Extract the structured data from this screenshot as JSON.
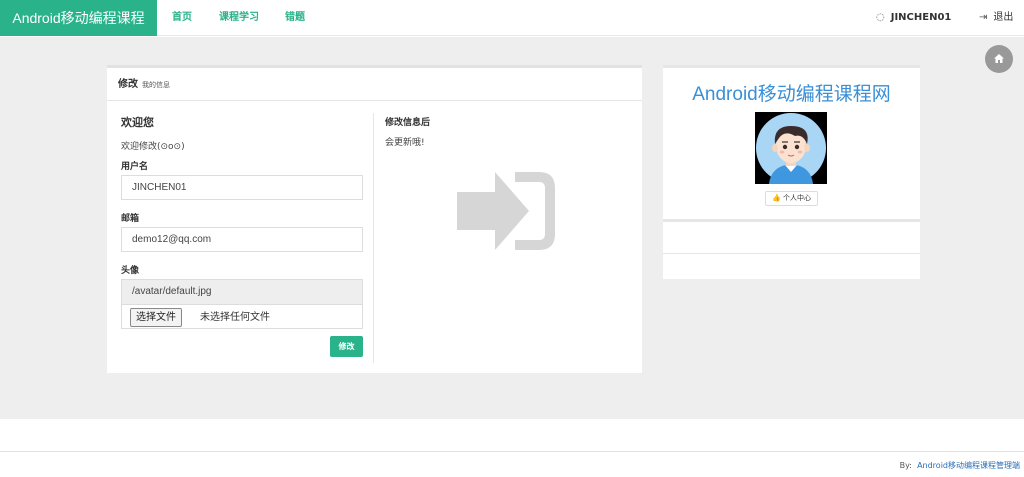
{
  "navbar": {
    "brand": "Android移动编程课程",
    "links": [
      "首页",
      "课程学习",
      "错题"
    ],
    "user": "JINCHEN01",
    "logout": "退出"
  },
  "panel": {
    "title": "修改",
    "subtitle": "我的信息",
    "welcome_heading": "欢迎您",
    "welcome_text": "欢迎修改(⊙o⊙)",
    "username_label": "用户名",
    "username_value": "JINCHEN01",
    "email_label": "邮箱",
    "email_value": "demo12@qq.com",
    "avatar_label": "头像",
    "avatar_value": "/avatar/default.jpg",
    "file_button": "选择文件",
    "file_status": "未选择任何文件",
    "submit_label": "修改",
    "right_heading": "修改信息后",
    "right_text": "会更新哦!"
  },
  "card": {
    "title": "Android移动编程课程网",
    "profile_button": "个人中心"
  },
  "footer": {
    "by": "By:",
    "link": "Android移动编程课程管理端"
  },
  "colors": {
    "brand": "#2ab28a",
    "title_blue": "#3a8fd6",
    "background": "#eeeeee"
  },
  "icons": [
    "home-icon",
    "user-icon",
    "logout-icon",
    "sign-in-icon",
    "thumbs-up-icon"
  ]
}
